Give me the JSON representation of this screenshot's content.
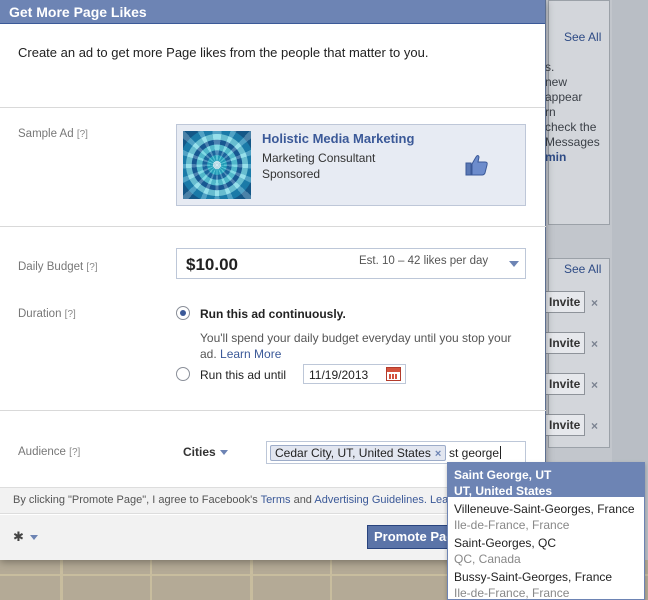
{
  "dialog": {
    "title": "Get More Page Likes",
    "intro": "Create an ad to get more Page likes from the people that matter to you."
  },
  "sample_ad": {
    "label": "Sample Ad",
    "help": "[?]",
    "page_name": "Holistic Media Marketing",
    "category": "Marketing Consultant",
    "sponsored": "Sponsored",
    "icon": "thumbs-up-icon"
  },
  "budget": {
    "label": "Daily Budget",
    "help": "[?]",
    "amount": "$10.00",
    "estimate": "Est. 10 – 42 likes per day"
  },
  "duration": {
    "label": "Duration",
    "help": "[?]",
    "option_continuous": "Run this ad continuously.",
    "help_text": "You'll spend your daily budget everyday until you stop your ad.",
    "learn_more": "Learn More",
    "option_until": "Run this ad until",
    "date": "11/19/2013",
    "selected": "continuous"
  },
  "audience": {
    "label": "Audience",
    "help": "[?]",
    "type": "Cities",
    "token": "Cedar City, UT, United States",
    "token_remove": "×",
    "query": "st george"
  },
  "suggestions": [
    {
      "name": "Saint George, UT",
      "sub": "UT, United States",
      "highlighted": true
    },
    {
      "name": "Villeneuve-Saint-Georges, France",
      "sub": "Ile-de-France, France",
      "highlighted": false
    },
    {
      "name": "Saint-Georges, QC",
      "sub": "QC, Canada",
      "highlighted": false
    },
    {
      "name": "Bussy-Saint-Georges, France",
      "sub": "Ile-de-France, France",
      "highlighted": false
    }
  ],
  "terms": {
    "prefix": "By clicking \"Promote Page\", I agree to Facebook's ",
    "terms_link": "Terms",
    "and": " and ",
    "guidelines_link": "Advertising Guidelines",
    "suffix": ". Learn"
  },
  "footer": {
    "promote_button": "Promote Page"
  },
  "background": {
    "see_all": "See All",
    "see_all_2": "See All",
    "snippet_lines": [
      "s.",
      "new",
      "appear",
      "rn",
      "check the",
      "Messages",
      "min"
    ],
    "invite": "Invite",
    "remove": "×"
  },
  "colors": {
    "title_bar": "#6d84b4",
    "link": "#3b5998",
    "button": "#5b74a8"
  }
}
